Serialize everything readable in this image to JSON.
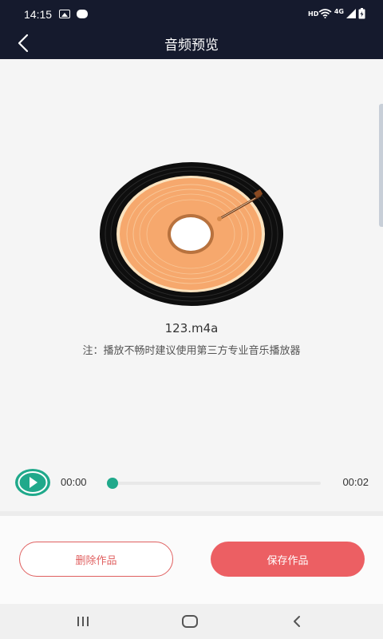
{
  "status_bar": {
    "time": "14:15",
    "hd": "HD",
    "network": "4G",
    "icons": [
      "image-icon",
      "notification-icon",
      "wifi-icon",
      "signal-icon",
      "battery-charging-icon"
    ]
  },
  "header": {
    "title": "音频预览",
    "back_icon": "chevron-left-icon"
  },
  "preview": {
    "filename": "123.m4a",
    "note": "注：播放不畅时建议使用第三方专业音乐播放器"
  },
  "player": {
    "current_time": "00:00",
    "duration": "00:02",
    "progress": 0.0,
    "accent": "#20a98b"
  },
  "actions": {
    "delete_label": "删除作品",
    "save_label": "保存作品",
    "delete_color": "#e06060",
    "save_color": "#ec5f63"
  },
  "system_nav": {
    "icons": [
      "recent-apps-icon",
      "home-icon",
      "back-icon"
    ]
  },
  "colors": {
    "header_bg": "#151a2d",
    "disc_orange": "#f6a86d"
  }
}
